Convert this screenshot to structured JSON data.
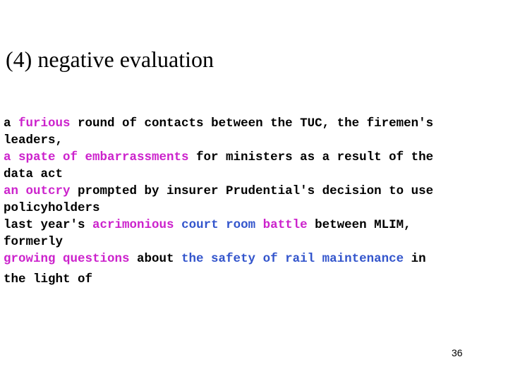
{
  "slide": {
    "title": "(4) negative evaluation",
    "page_number": "36",
    "colors": {
      "background": "#ffffff",
      "text": "#000000",
      "highlight_magenta": "#cc22cc",
      "highlight_blue": "#3355cc"
    },
    "body_lines": [
      {
        "id": "line-1",
        "spaced": false,
        "runs": [
          {
            "text": "a ",
            "color": "black"
          },
          {
            "text": "furious",
            "color": "magenta"
          },
          {
            "text": " round of contacts between the TUC, the firemen's",
            "color": "black"
          }
        ]
      },
      {
        "id": "line-2",
        "spaced": false,
        "runs": [
          {
            "text": "leaders,",
            "color": "black"
          }
        ]
      },
      {
        "id": "line-3",
        "spaced": false,
        "runs": [
          {
            "text": "a spate of embarrassments",
            "color": "magenta"
          },
          {
            "text": " for ministers as a result of the",
            "color": "black"
          }
        ]
      },
      {
        "id": "line-4",
        "spaced": false,
        "runs": [
          {
            "text": "data act",
            "color": "black"
          }
        ]
      },
      {
        "id": "line-5",
        "spaced": false,
        "runs": [
          {
            "text": "an outcry",
            "color": "magenta"
          },
          {
            "text": " prompted by insurer Prudential's decision to use",
            "color": "black"
          }
        ]
      },
      {
        "id": "line-6",
        "spaced": false,
        "runs": [
          {
            "text": "policyholders",
            "color": "black"
          }
        ]
      },
      {
        "id": "line-7",
        "spaced": false,
        "runs": [
          {
            "text": "last year's ",
            "color": "black"
          },
          {
            "text": "acrimonious",
            "color": "magenta"
          },
          {
            "text": " ",
            "color": "black"
          },
          {
            "text": "court room",
            "color": "blue"
          },
          {
            "text": " ",
            "color": "black"
          },
          {
            "text": "battle",
            "color": "magenta"
          },
          {
            "text": " between MLIM,",
            "color": "black"
          }
        ]
      },
      {
        "id": "line-8",
        "spaced": false,
        "runs": [
          {
            "text": "formerly",
            "color": "black"
          }
        ]
      },
      {
        "id": "line-9",
        "spaced": false,
        "runs": [
          {
            "text": "growing questions",
            "color": "magenta"
          },
          {
            "text": " about ",
            "color": "black"
          },
          {
            "text": "the safety of rail maintenance",
            "color": "blue"
          },
          {
            "text": " in",
            "color": "black"
          }
        ]
      },
      {
        "id": "line-10",
        "spaced": true,
        "runs": [
          {
            "text": "the light of",
            "color": "black"
          }
        ]
      }
    ]
  }
}
